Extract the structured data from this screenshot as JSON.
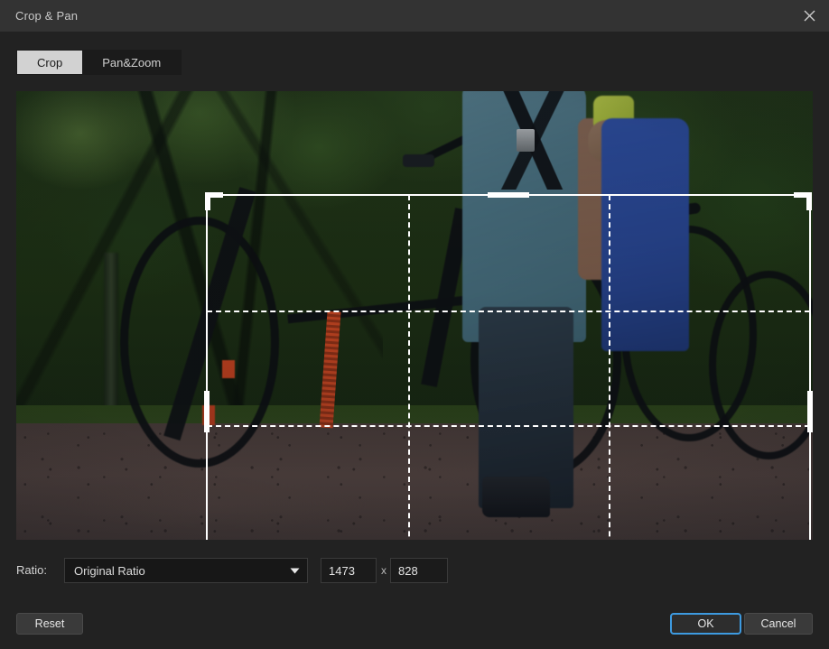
{
  "window": {
    "title": "Crop & Pan",
    "close_icon": "close-icon"
  },
  "tabs": [
    {
      "label": "Crop",
      "active": true
    },
    {
      "label": "Pan&Zoom",
      "active": false
    }
  ],
  "preview": {
    "description": "Two mountain bikers walking bikes along a forest dirt trail at dusk",
    "crop_overlay": {
      "grid": "rule-of-thirds",
      "handles": [
        "top-left",
        "top-center",
        "top-right",
        "middle-left",
        "middle-right",
        "bottom-left",
        "bottom-center",
        "bottom-right"
      ],
      "line_color": "#ffffff"
    }
  },
  "ratio": {
    "label": "Ratio:",
    "selected": "Original Ratio",
    "dropdown_icon": "chevron-down-icon",
    "width_value": "1473",
    "separator": "x",
    "height_value": "828"
  },
  "footer": {
    "reset_label": "Reset",
    "ok_label": "OK",
    "cancel_label": "Cancel",
    "focus_color": "#3d9ae0"
  }
}
